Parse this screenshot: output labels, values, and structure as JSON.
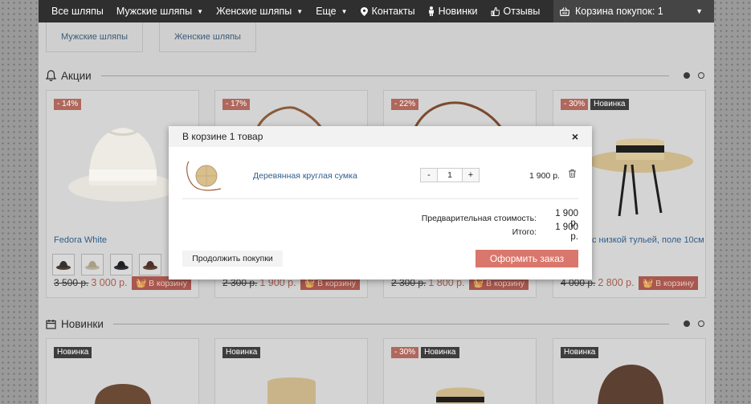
{
  "nav": {
    "items": [
      {
        "label": "Все шляпы",
        "icon": "",
        "caret": false
      },
      {
        "label": "Мужские шляпы",
        "icon": "",
        "caret": true
      },
      {
        "label": "Женские шляпы",
        "icon": "",
        "caret": true
      },
      {
        "label": "Еще",
        "icon": "",
        "caret": true
      },
      {
        "label": "Контакты",
        "icon": "map-pin-icon",
        "caret": false
      },
      {
        "label": "Новинки",
        "icon": "person-icon",
        "caret": false
      },
      {
        "label": "Отзывы",
        "icon": "thumbs-up-icon",
        "caret": false
      }
    ],
    "cart_label": "Корзина покупок: 1"
  },
  "subcategories": [
    "Мужские шляпы",
    "Женские шляпы"
  ],
  "sections": {
    "promo_title": "Акции",
    "new_title": "Новинки"
  },
  "promo_products": [
    {
      "badges": [
        "- 14%"
      ],
      "name": "Fedora White",
      "old_price": "3 500 р.",
      "price": "3 000 р.",
      "buy_label": "В корзину"
    },
    {
      "badges": [
        "- 17%"
      ],
      "name": "",
      "old_price": "2 300 р.",
      "price": "1 900 р.",
      "buy_label": "В корзину"
    },
    {
      "badges": [
        "- 22%"
      ],
      "name": "",
      "old_price": "2 300 р.",
      "price": "1 800 р.",
      "buy_label": "В корзину"
    },
    {
      "badges": [
        "- 30%",
        "Новинка"
      ],
      "name": "с низкой тульей, поле 10см",
      "old_price": "4 000 р.",
      "price": "2 800 р.",
      "buy_label": "В корзину"
    }
  ],
  "new_products": [
    {
      "badges": [
        "Новинка"
      ]
    },
    {
      "badges": [
        "Новинка"
      ]
    },
    {
      "badges": [
        "- 30%",
        "Новинка"
      ]
    },
    {
      "badges": [
        "Новинка"
      ]
    }
  ],
  "modal": {
    "title": "В корзине 1 товар",
    "item_name": "Деревянная круглая сумка",
    "qty": "1",
    "minus": "-",
    "plus": "+",
    "item_price": "1 900 р.",
    "subtotal_label": "Предварительная стоимость:",
    "subtotal_value": "1 900 р.",
    "total_label": "Итого:",
    "total_value": "1 900 р.",
    "continue_label": "Продолжить покупки",
    "order_label": "Оформить заказ",
    "close": "×"
  },
  "colors": {
    "nav_bg": "#2f2f2f",
    "sale_badge": "#b0685d",
    "new_badge": "#3d3d3d",
    "price": "#a85a50",
    "order_button": "#d9776c",
    "link": "#2f5d8a"
  }
}
